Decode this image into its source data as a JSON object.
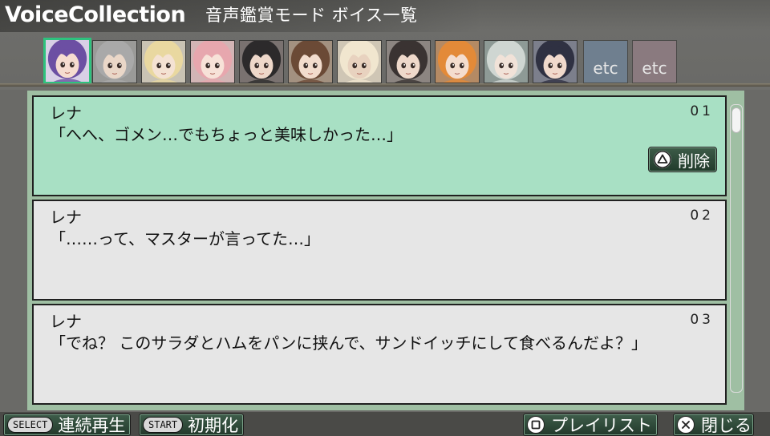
{
  "header": {
    "app_title": "VoiceCollection",
    "mode_title": "音声鑑賞モード  ボイス一覧"
  },
  "character_tabs": [
    {
      "name": "char-1",
      "hair": "#6c4fa3",
      "skin": "#f6dcd0",
      "bg": "#d8d0e6",
      "selected": true
    },
    {
      "name": "char-2",
      "hair": "#a9a9a9",
      "skin": "#ead7c8",
      "bg": "#9a9a98"
    },
    {
      "name": "char-3",
      "hair": "#e9d8a0",
      "skin": "#f4e2d3",
      "bg": "#c9c3b4"
    },
    {
      "name": "char-4",
      "hair": "#e7a7ae",
      "skin": "#f7e2d8",
      "bg": "#d2b5b5"
    },
    {
      "name": "char-5",
      "hair": "#2c2a2b",
      "skin": "#eed8ca",
      "bg": "#7a7270"
    },
    {
      "name": "char-6",
      "hair": "#6b4a36",
      "skin": "#f2dccd",
      "bg": "#a39180"
    },
    {
      "name": "char-7",
      "hair": "#f1e6cf",
      "skin": "#e8d2bf",
      "bg": "#cfc6b5"
    },
    {
      "name": "char-8",
      "hair": "#3a3332",
      "skin": "#efd9cb",
      "bg": "#8c8581"
    },
    {
      "name": "char-9",
      "hair": "#e38a38",
      "skin": "#f4ddce",
      "bg": "#b48a64"
    },
    {
      "name": "char-10",
      "hair": "#cfd6d2",
      "skin": "#f1e2d8",
      "bg": "#8e9a96"
    },
    {
      "name": "char-11",
      "hair": "#2f3142",
      "skin": "#f0d9cc",
      "bg": "#7c7f8c"
    }
  ],
  "etc_tabs": [
    {
      "label": "etc",
      "color": "#6f7f8f"
    },
    {
      "label": "etc",
      "color": "#8a7a7f"
    }
  ],
  "voice_list": [
    {
      "speaker": "レナ",
      "number": "01",
      "line": "「へへ、ゴメン…でもちょっと美味しかった…」"
    },
    {
      "speaker": "レナ",
      "number": "02",
      "line": "「……って、マスターが言ってた…」"
    },
    {
      "speaker": "レナ",
      "number": "03",
      "line": "「でね？ このサラダとハムをパンに挟んで、サンドイッチにして食べるんだよ？」"
    }
  ],
  "delete_button": {
    "label": "削除",
    "icon": "triangle-button-icon"
  },
  "footer": {
    "select_key": "SELECT",
    "select_label": "連続再生",
    "start_key": "START",
    "start_label": "初期化",
    "playlist_label": "プレイリスト",
    "playlist_icon": "square-button-icon",
    "close_label": "閉じる",
    "close_icon": "cross-button-icon"
  },
  "colors": {
    "selected_entry": "#a8e0c4",
    "entry": "#e6e6e6",
    "panel": "#9fbfa3",
    "accent": "#2ec27e"
  }
}
